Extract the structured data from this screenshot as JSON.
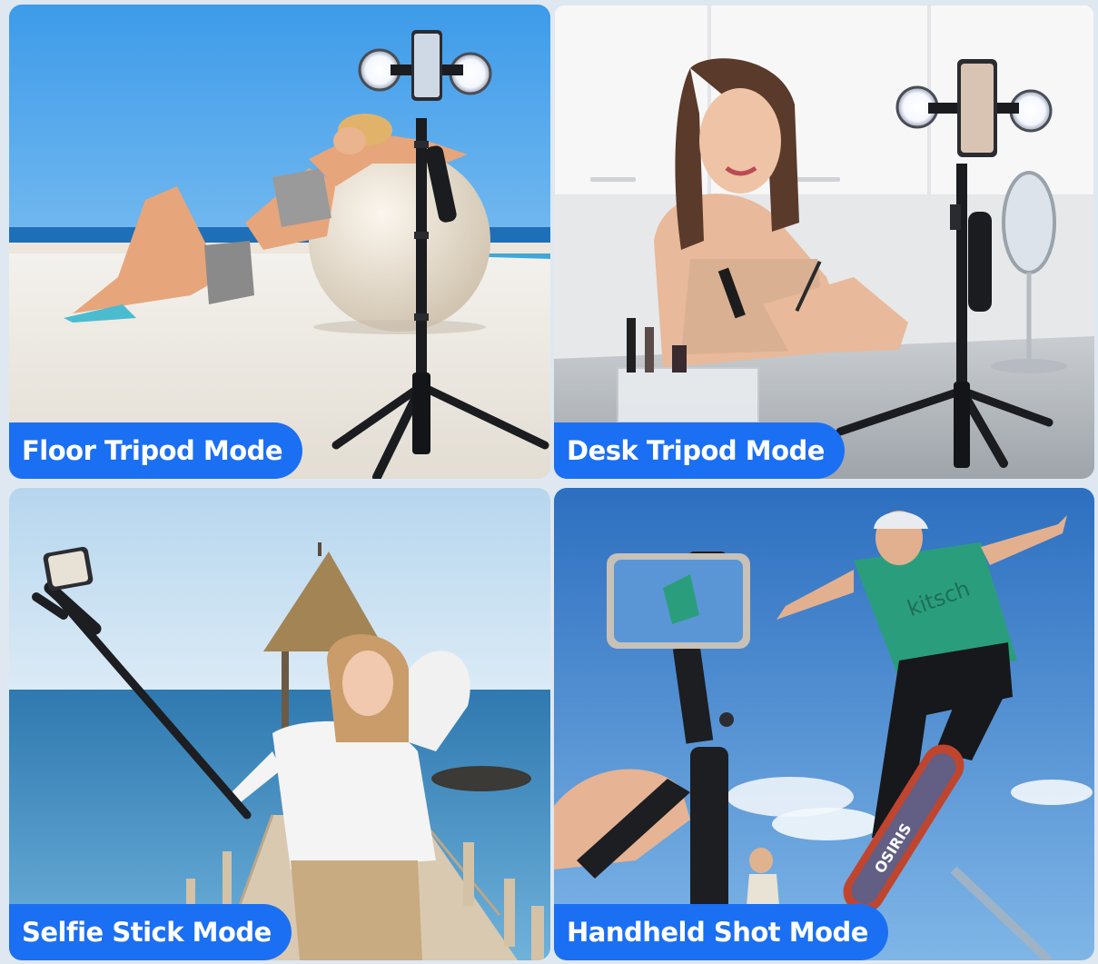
{
  "panels": [
    {
      "label": "Floor Tripod Mode"
    },
    {
      "label": "Desk Tripod Mode"
    },
    {
      "label": "Selfie Stick Mode"
    },
    {
      "label": "Handheld Shot Mode"
    }
  ],
  "skateboard_shirt_text": "kitsch",
  "skateboard_deck_text": "OSIRIS",
  "colors": {
    "label_background": "#1b6ff2",
    "label_text": "#ffffff"
  }
}
